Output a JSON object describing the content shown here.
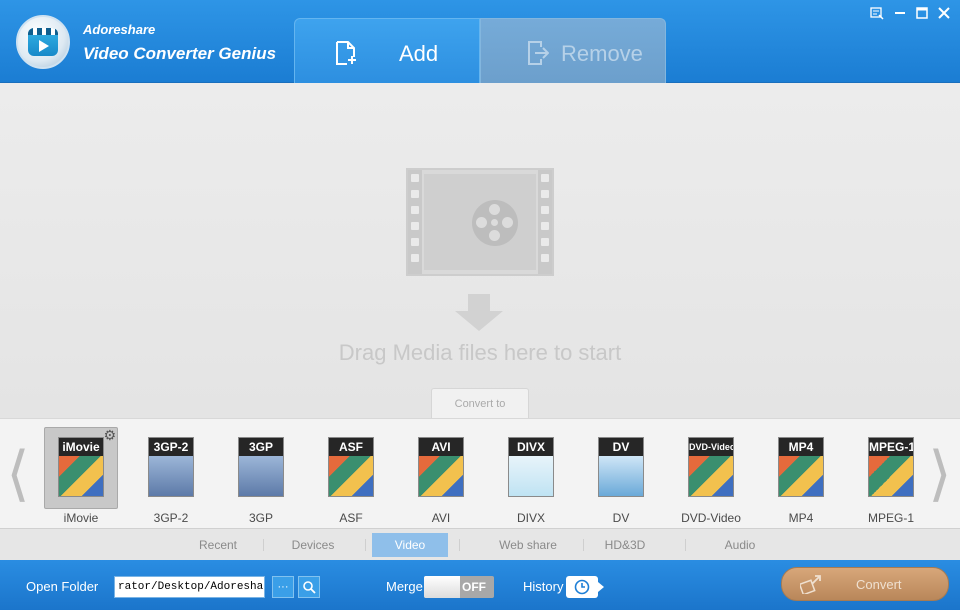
{
  "app": {
    "brand_line1": "Adoreshare",
    "brand_line2": "Video Converter Genius"
  },
  "toolbar": {
    "add_label": "Add",
    "remove_label": "Remove"
  },
  "window_controls": [
    "feedback-icon",
    "minimize-icon",
    "maximize-icon",
    "close-icon"
  ],
  "dropzone": {
    "hint": "Drag Media files here to start",
    "convert_to_label": "Convert to"
  },
  "formats": [
    {
      "tag": "iMovie",
      "name": "iMovie",
      "selected": true
    },
    {
      "tag": "3GP-2",
      "name": "3GP-2"
    },
    {
      "tag": "3GP",
      "name": "3GP"
    },
    {
      "tag": "ASF",
      "name": "ASF"
    },
    {
      "tag": "AVI",
      "name": "AVI"
    },
    {
      "tag": "DIVX",
      "name": "DIVX"
    },
    {
      "tag": "DV",
      "name": "DV"
    },
    {
      "tag": "DVD-Video",
      "name": "DVD-Video"
    },
    {
      "tag": "MP4",
      "name": "MP4"
    },
    {
      "tag": "MPEG-1",
      "name": "MPEG-1"
    }
  ],
  "categories": [
    {
      "label": "Recent"
    },
    {
      "label": "Devices"
    },
    {
      "label": "Video",
      "active": true
    },
    {
      "label": "Web share"
    },
    {
      "label": "HD&3D"
    },
    {
      "label": "Audio"
    }
  ],
  "bottom": {
    "open_folder_label": "Open Folder",
    "output_path": "rator/Desktop/Adoreshare",
    "browse_label": "···",
    "merge_label": "Merge",
    "merge_state": "OFF",
    "history_label": "History",
    "convert_label": "Convert"
  },
  "colors": {
    "header_blue": "#2e95e6",
    "bottom_blue": "#1b75cb",
    "active_tab": "#8fbfea",
    "convert_button": "#c8966a"
  }
}
